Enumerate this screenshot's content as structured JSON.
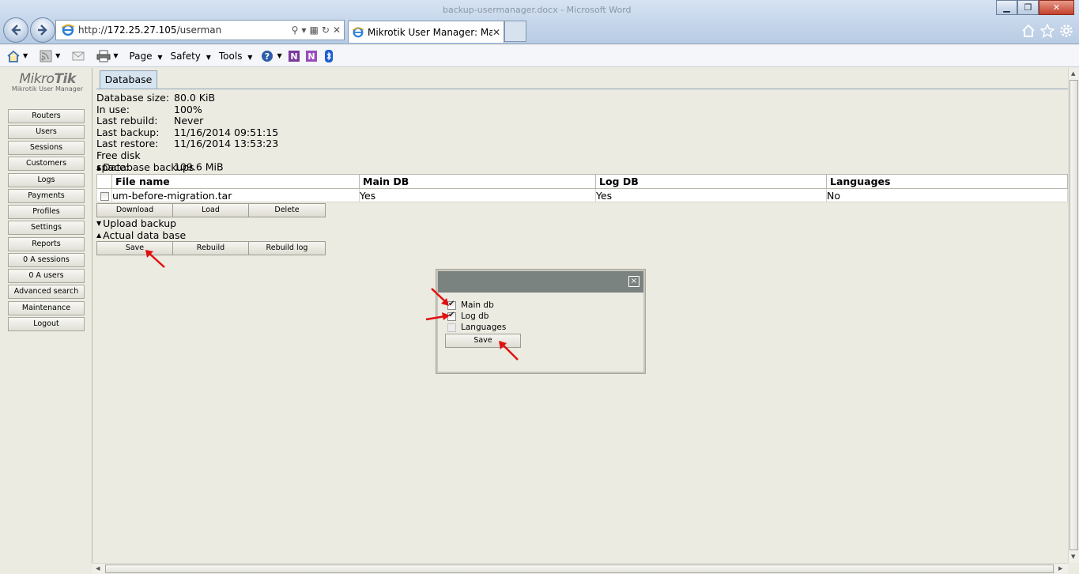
{
  "browser": {
    "window_title": "backup-usermanager.docx - Microsoft Word",
    "url_prefix": "http://",
    "url_host": "172.25.27.105",
    "url_path": "/userman",
    "tab_title": "Mikrotik User Manager: Mai...",
    "menus": {
      "page": "Page",
      "safety": "Safety",
      "tools": "Tools"
    }
  },
  "logo": {
    "brand_light": "Mikro",
    "brand_bold": "Tik",
    "subtitle": "Mikrotik User Manager"
  },
  "sidebar": {
    "items": [
      {
        "label": "Routers"
      },
      {
        "label": "Users"
      },
      {
        "label": "Sessions"
      },
      {
        "label": "Customers"
      },
      {
        "label": "Logs"
      },
      {
        "label": "Payments"
      },
      {
        "label": "Profiles"
      },
      {
        "label": "Settings"
      },
      {
        "label": "Reports"
      },
      {
        "label": "0 A sessions"
      },
      {
        "label": "0 A users"
      },
      {
        "label": "Advanced search"
      },
      {
        "label": "Maintenance"
      },
      {
        "label": "Logout"
      }
    ]
  },
  "main": {
    "tab": "Database",
    "info": [
      {
        "key": "Database size:",
        "value": "80.0 KiB"
      },
      {
        "key": "In use:",
        "value": "100%"
      },
      {
        "key": "Last rebuild:",
        "value": "Never"
      },
      {
        "key": "Last backup:",
        "value": "11/16/2014 09:51:15"
      },
      {
        "key": "Last restore:",
        "value": "11/16/2014 13:53:23"
      },
      {
        "key": "Free disk space:",
        "value": "109.6 MiB"
      }
    ],
    "backups_section": "Database backups",
    "backups_table": {
      "headers": [
        "File name",
        "Main DB",
        "Log DB",
        "Languages"
      ],
      "rows": [
        {
          "file": "um-before-migration.tar",
          "main": "Yes",
          "log": "Yes",
          "languages": "No",
          "checked": false
        }
      ]
    },
    "backup_buttons": {
      "download": "Download",
      "load": "Load",
      "delete": "Delete"
    },
    "upload_section": "Upload backup",
    "actual_section": "Actual data base",
    "actual_buttons": {
      "save": "Save",
      "rebuild": "Rebuild",
      "rebuild_log": "Rebuild log"
    }
  },
  "dialog": {
    "close": "×",
    "options": [
      {
        "label": "Main db",
        "checked": true,
        "enabled": true
      },
      {
        "label": "Log db",
        "checked": true,
        "enabled": true
      },
      {
        "label": "Languages",
        "checked": false,
        "enabled": false
      }
    ],
    "save": "Save"
  },
  "colors": {
    "page_bg": "#ecebe2",
    "dialog_header": "#7b8380",
    "annotation_arrow": "#e01010",
    "tab_active": "#d5e4ef"
  }
}
